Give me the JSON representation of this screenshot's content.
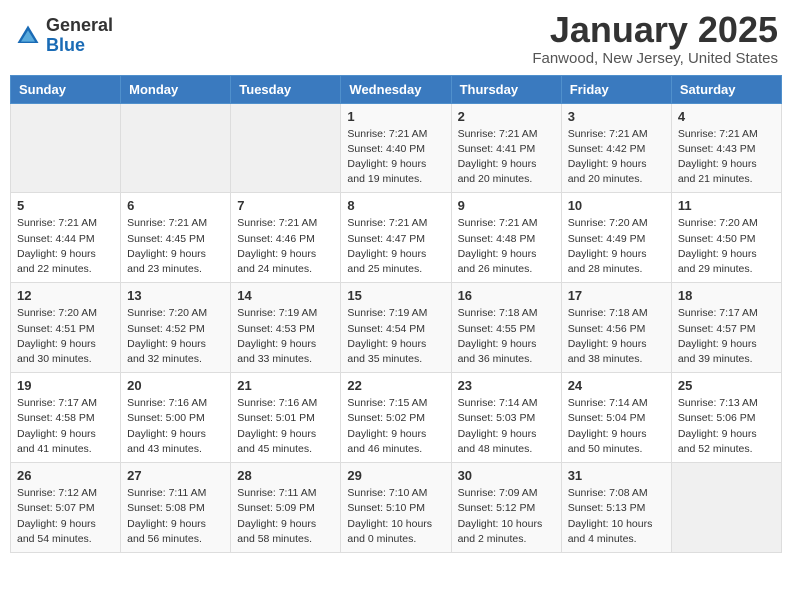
{
  "header": {
    "logo_general": "General",
    "logo_blue": "Blue",
    "month_title": "January 2025",
    "location": "Fanwood, New Jersey, United States"
  },
  "weekdays": [
    "Sunday",
    "Monday",
    "Tuesday",
    "Wednesday",
    "Thursday",
    "Friday",
    "Saturday"
  ],
  "weeks": [
    [
      {
        "day": "",
        "info": ""
      },
      {
        "day": "",
        "info": ""
      },
      {
        "day": "",
        "info": ""
      },
      {
        "day": "1",
        "info": "Sunrise: 7:21 AM\nSunset: 4:40 PM\nDaylight: 9 hours\nand 19 minutes."
      },
      {
        "day": "2",
        "info": "Sunrise: 7:21 AM\nSunset: 4:41 PM\nDaylight: 9 hours\nand 20 minutes."
      },
      {
        "day": "3",
        "info": "Sunrise: 7:21 AM\nSunset: 4:42 PM\nDaylight: 9 hours\nand 20 minutes."
      },
      {
        "day": "4",
        "info": "Sunrise: 7:21 AM\nSunset: 4:43 PM\nDaylight: 9 hours\nand 21 minutes."
      }
    ],
    [
      {
        "day": "5",
        "info": "Sunrise: 7:21 AM\nSunset: 4:44 PM\nDaylight: 9 hours\nand 22 minutes."
      },
      {
        "day": "6",
        "info": "Sunrise: 7:21 AM\nSunset: 4:45 PM\nDaylight: 9 hours\nand 23 minutes."
      },
      {
        "day": "7",
        "info": "Sunrise: 7:21 AM\nSunset: 4:46 PM\nDaylight: 9 hours\nand 24 minutes."
      },
      {
        "day": "8",
        "info": "Sunrise: 7:21 AM\nSunset: 4:47 PM\nDaylight: 9 hours\nand 25 minutes."
      },
      {
        "day": "9",
        "info": "Sunrise: 7:21 AM\nSunset: 4:48 PM\nDaylight: 9 hours\nand 26 minutes."
      },
      {
        "day": "10",
        "info": "Sunrise: 7:20 AM\nSunset: 4:49 PM\nDaylight: 9 hours\nand 28 minutes."
      },
      {
        "day": "11",
        "info": "Sunrise: 7:20 AM\nSunset: 4:50 PM\nDaylight: 9 hours\nand 29 minutes."
      }
    ],
    [
      {
        "day": "12",
        "info": "Sunrise: 7:20 AM\nSunset: 4:51 PM\nDaylight: 9 hours\nand 30 minutes."
      },
      {
        "day": "13",
        "info": "Sunrise: 7:20 AM\nSunset: 4:52 PM\nDaylight: 9 hours\nand 32 minutes."
      },
      {
        "day": "14",
        "info": "Sunrise: 7:19 AM\nSunset: 4:53 PM\nDaylight: 9 hours\nand 33 minutes."
      },
      {
        "day": "15",
        "info": "Sunrise: 7:19 AM\nSunset: 4:54 PM\nDaylight: 9 hours\nand 35 minutes."
      },
      {
        "day": "16",
        "info": "Sunrise: 7:18 AM\nSunset: 4:55 PM\nDaylight: 9 hours\nand 36 minutes."
      },
      {
        "day": "17",
        "info": "Sunrise: 7:18 AM\nSunset: 4:56 PM\nDaylight: 9 hours\nand 38 minutes."
      },
      {
        "day": "18",
        "info": "Sunrise: 7:17 AM\nSunset: 4:57 PM\nDaylight: 9 hours\nand 39 minutes."
      }
    ],
    [
      {
        "day": "19",
        "info": "Sunrise: 7:17 AM\nSunset: 4:58 PM\nDaylight: 9 hours\nand 41 minutes."
      },
      {
        "day": "20",
        "info": "Sunrise: 7:16 AM\nSunset: 5:00 PM\nDaylight: 9 hours\nand 43 minutes."
      },
      {
        "day": "21",
        "info": "Sunrise: 7:16 AM\nSunset: 5:01 PM\nDaylight: 9 hours\nand 45 minutes."
      },
      {
        "day": "22",
        "info": "Sunrise: 7:15 AM\nSunset: 5:02 PM\nDaylight: 9 hours\nand 46 minutes."
      },
      {
        "day": "23",
        "info": "Sunrise: 7:14 AM\nSunset: 5:03 PM\nDaylight: 9 hours\nand 48 minutes."
      },
      {
        "day": "24",
        "info": "Sunrise: 7:14 AM\nSunset: 5:04 PM\nDaylight: 9 hours\nand 50 minutes."
      },
      {
        "day": "25",
        "info": "Sunrise: 7:13 AM\nSunset: 5:06 PM\nDaylight: 9 hours\nand 52 minutes."
      }
    ],
    [
      {
        "day": "26",
        "info": "Sunrise: 7:12 AM\nSunset: 5:07 PM\nDaylight: 9 hours\nand 54 minutes."
      },
      {
        "day": "27",
        "info": "Sunrise: 7:11 AM\nSunset: 5:08 PM\nDaylight: 9 hours\nand 56 minutes."
      },
      {
        "day": "28",
        "info": "Sunrise: 7:11 AM\nSunset: 5:09 PM\nDaylight: 9 hours\nand 58 minutes."
      },
      {
        "day": "29",
        "info": "Sunrise: 7:10 AM\nSunset: 5:10 PM\nDaylight: 10 hours\nand 0 minutes."
      },
      {
        "day": "30",
        "info": "Sunrise: 7:09 AM\nSunset: 5:12 PM\nDaylight: 10 hours\nand 2 minutes."
      },
      {
        "day": "31",
        "info": "Sunrise: 7:08 AM\nSunset: 5:13 PM\nDaylight: 10 hours\nand 4 minutes."
      },
      {
        "day": "",
        "info": ""
      }
    ]
  ]
}
